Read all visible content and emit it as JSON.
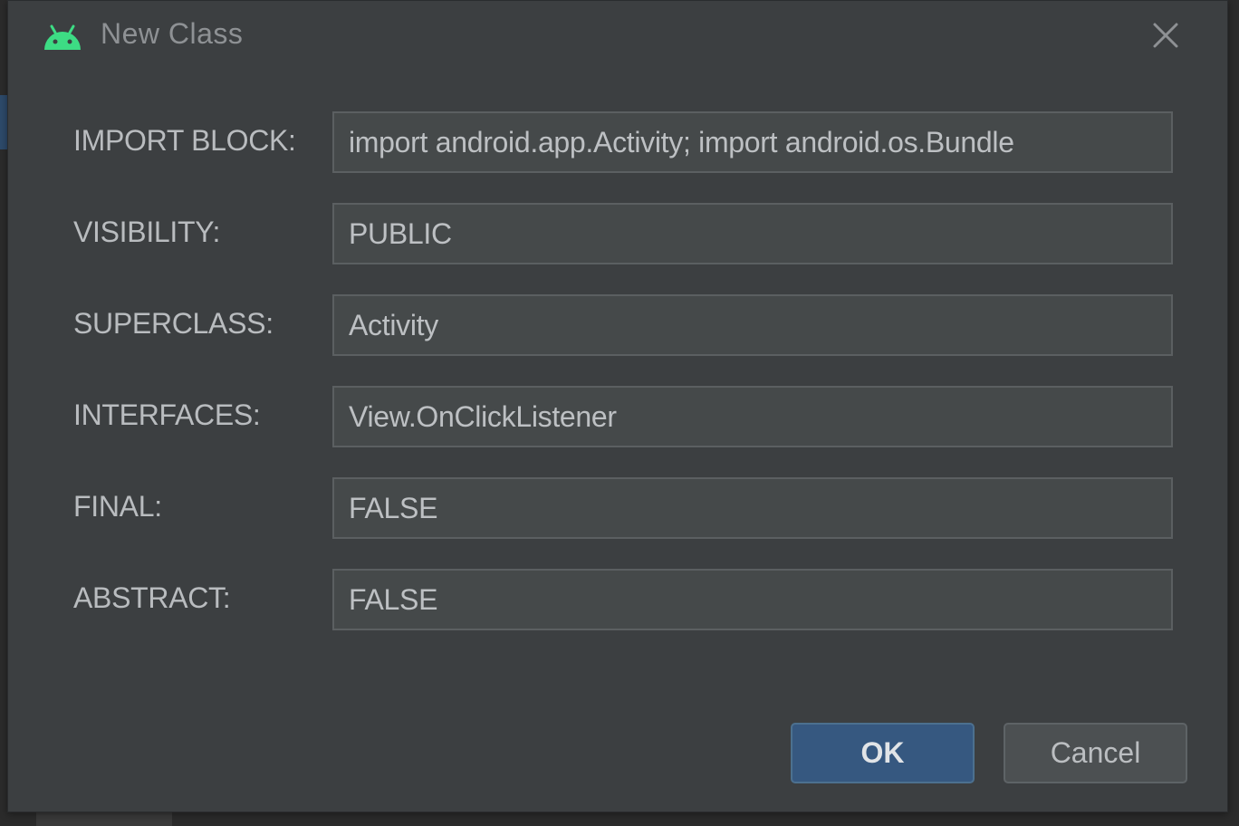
{
  "dialog": {
    "title": "New Class",
    "icons": {
      "app": "android-icon",
      "close": "close-icon"
    }
  },
  "form": {
    "fields": [
      {
        "key": "import_block",
        "label": "IMPORT BLOCK:",
        "value": "import android.app.Activity; import android.os.Bundle"
      },
      {
        "key": "visibility",
        "label": "VISIBILITY:",
        "value": "PUBLIC"
      },
      {
        "key": "superclass",
        "label": "SUPERCLASS:",
        "value": "Activity"
      },
      {
        "key": "interfaces",
        "label": "INTERFACES:",
        "value": "View.OnClickListener"
      },
      {
        "key": "final",
        "label": "FINAL:",
        "value": "FALSE"
      },
      {
        "key": "abstract",
        "label": "ABSTRACT:",
        "value": "FALSE"
      }
    ]
  },
  "buttons": {
    "ok_label": "OK",
    "cancel_label": "Cancel"
  },
  "colors": {
    "android_green": "#3ddc84",
    "primary_button": "#365880",
    "dialog_background": "#3c3f41"
  }
}
